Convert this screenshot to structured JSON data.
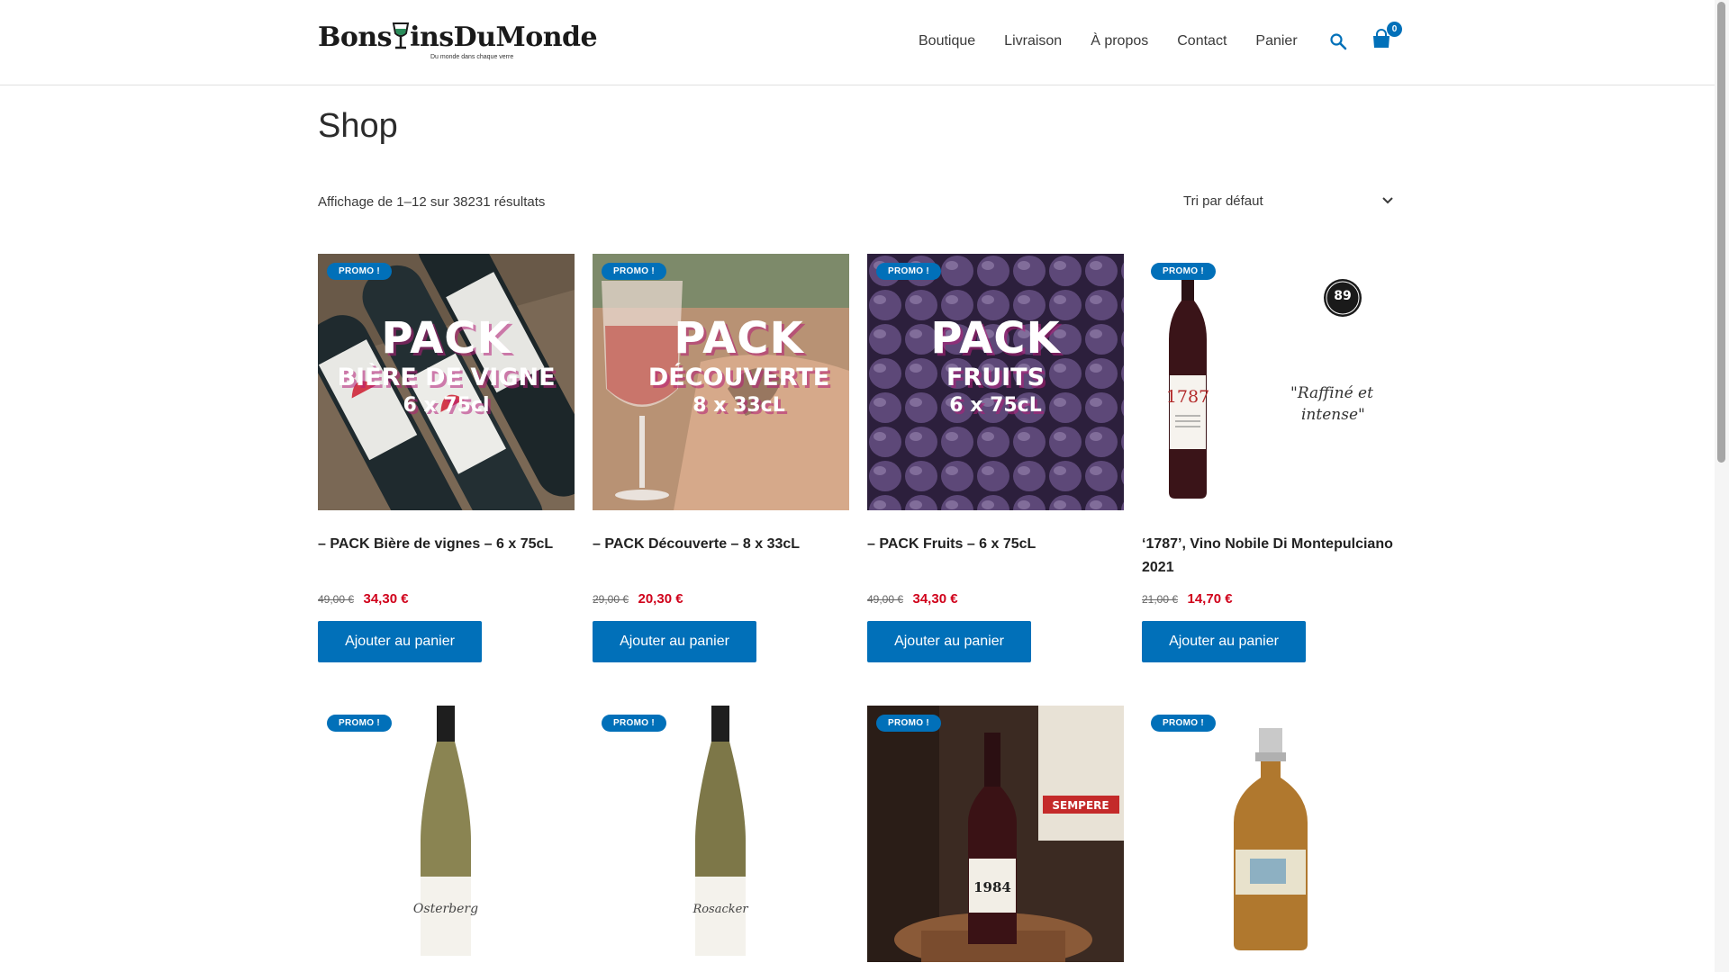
{
  "header": {
    "logo_text_a": "Bons",
    "logo_text_b": "insDuMonde",
    "logo_tagline": "Du monde dans chaque verre",
    "nav": [
      "Boutique",
      "Livraison",
      "À propos",
      "Contact",
      "Panier"
    ],
    "cart_count": "0",
    "accent": "#0170b9"
  },
  "main": {
    "title": "Shop",
    "result_count": "Affichage de 1–12 sur 38231 résultats",
    "sort_selected": "Tri par défaut"
  },
  "products": [
    {
      "badge": "PROMO !",
      "title": "– PACK Bière de vignes – 6 x 75cL",
      "old_price": "49,00 €",
      "price": "34,30 €",
      "button": "Ajouter au panier",
      "img_text": [
        "PACK",
        "BIÈRE DE VIGNE",
        "6 x 75cl"
      ]
    },
    {
      "badge": "PROMO !",
      "title": "– PACK Découverte – 8 x 33cL",
      "old_price": "29,00 €",
      "price": "20,30 €",
      "button": "Ajouter au panier",
      "img_text": [
        "PACK",
        "DÉCOUVERTE",
        "8 x 33cL"
      ]
    },
    {
      "badge": "PROMO !",
      "title": "– PACK Fruits – 6 x 75cL",
      "old_price": "49,00 €",
      "price": "34,30 €",
      "button": "Ajouter au panier",
      "img_text": [
        "PACK",
        "FRUITS",
        "6 x 75cL"
      ]
    },
    {
      "badge": "PROMO !",
      "title": "‘1787’, Vino Nobile Di Montepulciano 2021",
      "old_price": "21,00 €",
      "price": "14,70 €",
      "button": "Ajouter au panier",
      "img_text": [
        "\"Raffiné et",
        "intense\"",
        "89",
        "1787"
      ]
    },
    {
      "badge": "PROMO !",
      "img_text": [
        "Osterberg"
      ]
    },
    {
      "badge": "PROMO !",
      "img_text": [
        "Rosacker"
      ]
    },
    {
      "badge": "PROMO !",
      "img_text": [
        "1984",
        "SEMPERE"
      ]
    },
    {
      "badge": "PROMO !"
    }
  ]
}
